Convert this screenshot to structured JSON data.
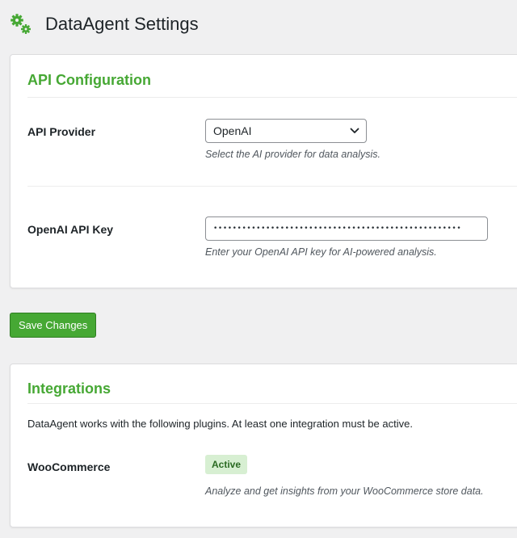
{
  "header": {
    "title": "DataAgent Settings",
    "icon": "gears-icon",
    "icon_color": "#46a834"
  },
  "api_config": {
    "title": "API Configuration",
    "provider": {
      "label": "API Provider",
      "selected": "OpenAI",
      "description": "Select the AI provider for data analysis."
    },
    "api_key": {
      "label": "OpenAI API Key",
      "masked_value": "••••••••••••••••••••••••••••••••••••••••••••••••••••",
      "description": "Enter your OpenAI API key for AI-powered analysis."
    }
  },
  "save_button": {
    "label": "Save Changes"
  },
  "integrations": {
    "title": "Integrations",
    "intro": "DataAgent works with the following plugins. At least one integration must be active.",
    "items": [
      {
        "name": "WooCommerce",
        "status": "Active",
        "description": "Analyze and get insights from your WooCommerce store data."
      }
    ]
  },
  "colors": {
    "accent": "#46a834",
    "badge_bg": "#d7efd2",
    "badge_text": "#2a6a22",
    "background": "#f0f0f1"
  }
}
